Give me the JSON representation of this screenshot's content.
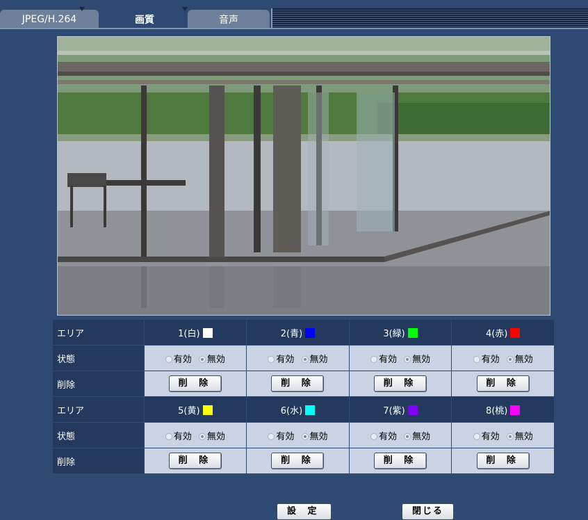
{
  "tabs": [
    {
      "label": "JPEG/H.264"
    },
    {
      "label": "画質"
    },
    {
      "label": "音声"
    }
  ],
  "labels": {
    "area": "エリア",
    "status": "状態",
    "delete": "削除"
  },
  "status_options": {
    "enabled": "有効",
    "disabled": "無効"
  },
  "delete_button": "削 除",
  "areas": [
    {
      "name": "1(白)",
      "color": "#ffffff",
      "status": "無効"
    },
    {
      "name": "2(青)",
      "color": "#0000ff",
      "status": "無効"
    },
    {
      "name": "3(緑)",
      "color": "#00ff00",
      "status": "無効"
    },
    {
      "name": "4(赤)",
      "color": "#ff0000",
      "status": "無効"
    },
    {
      "name": "5(黄)",
      "color": "#ffff00",
      "status": "無効"
    },
    {
      "name": "6(水)",
      "color": "#00ffff",
      "status": "無効"
    },
    {
      "name": "7(紫)",
      "color": "#8000ff",
      "status": "無効"
    },
    {
      "name": "8(桃)",
      "color": "#ff00ff",
      "status": "無効"
    }
  ],
  "footer": {
    "set_label": "設 定",
    "close_label": "閉じる"
  },
  "colors": {
    "background": "#2f4a72",
    "header_cell": "#233a5e",
    "body_cell": "#c9d3e3"
  }
}
